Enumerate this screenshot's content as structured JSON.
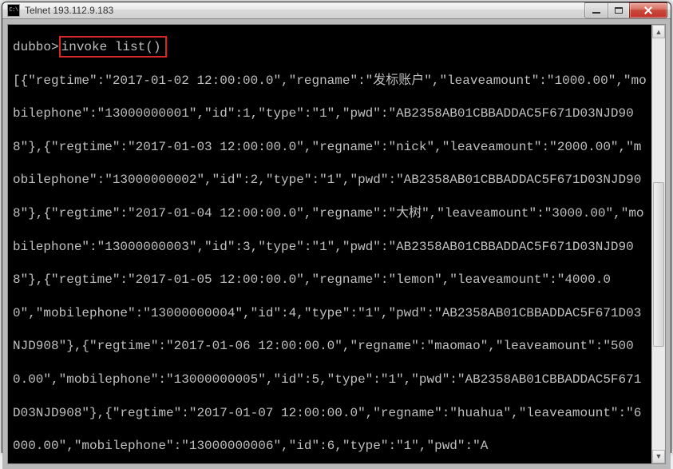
{
  "window": {
    "title_icon_text": "C:\\",
    "title": "Telnet 193.112.9.183"
  },
  "terminal": {
    "prompt": "dubbo>",
    "command": "invoke list()",
    "output": "[{\"regtime\":\"2017-01-02 12:00:00.0\",\"regname\":\"发标账户\",\"leaveamount\":\"1000.00\",\"mobilephone\":\"13000000001\",\"id\":1,\"type\":\"1\",\"pwd\":\"AB2358AB01CBBADDAC5F671D03NJD908\"},{\"regtime\":\"2017-01-03 12:00:00.0\",\"regname\":\"nick\",\"leaveamount\":\"2000.00\",\"mobilephone\":\"13000000002\",\"id\":2,\"type\":\"1\",\"pwd\":\"AB2358AB01CBBADDAC5F671D03NJD908\"},{\"regtime\":\"2017-01-04 12:00:00.0\",\"regname\":\"大树\",\"leaveamount\":\"3000.00\",\"mobilephone\":\"13000000003\",\"id\":3,\"type\":\"1\",\"pwd\":\"AB2358AB01CBBADDAC5F671D03NJD908\"},{\"regtime\":\"2017-01-05 12:00:00.0\",\"regname\":\"lemon\",\"leaveamount\":\"4000.00\",\"mobilephone\":\"13000000004\",\"id\":4,\"type\":\"1\",\"pwd\":\"AB2358AB01CBBADDAC5F671D03NJD908\"},{\"regtime\":\"2017-01-06 12:00:00.0\",\"regname\":\"maomao\",\"leaveamount\":\"5000.00\",\"mobilephone\":\"13000000005\",\"id\":5,\"type\":\"1\",\"pwd\":\"AB2358AB01CBBADDAC5F671D03NJD908\"},{\"regtime\":\"2017-01-07 12:00:00.0\",\"regname\":\"huahua\",\"leaveamount\":\"6000.00\",\"mobilephone\":\"13000000006\",\"id\":6,\"type\":\"1\",\"pwd\":\"A"
  }
}
